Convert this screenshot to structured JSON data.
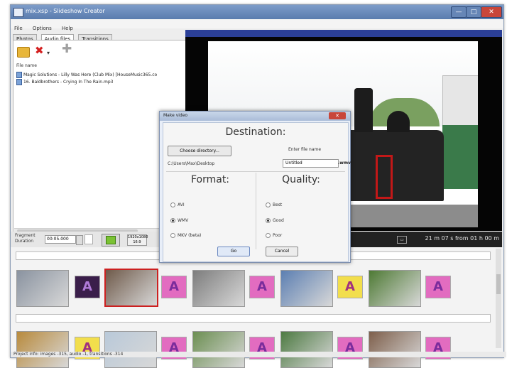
{
  "window": {
    "title": "mix.xsp - Slideshow Creator",
    "min": "—",
    "max": "□",
    "close": "✕"
  },
  "menu": [
    "File",
    "Options",
    "Help"
  ],
  "tabs": [
    "Photos",
    "Audio files",
    "Transitions"
  ],
  "audio_list": {
    "column": "File name",
    "files": [
      "Magic Solutions - Lilly Was Here (Club Mix) [HouseMusic365.co",
      "16. Baldbrothers - Crying In The Rain.mp3"
    ]
  },
  "toolbar_icons": [
    "folder-open-icon",
    "remove-icon",
    "dropdown-icon",
    "add-icon"
  ],
  "fragment": {
    "label_line1": "Fragment",
    "label_line2": "Duration",
    "value": "00:05.000",
    "resolution_line1": "1920x1080",
    "resolution_line2": "16:9"
  },
  "preview": {
    "time_text": "21 m 07 s   from 01 h 00 m",
    "icon": "▭"
  },
  "status": "Project info: images -315, audio -1, transitions -314",
  "dialog": {
    "title": "Make video",
    "close": "✕",
    "destination": "Destination:",
    "choose_dir": "Choose directory...",
    "file_name_label": "Enter file name",
    "directory": "C:\\Users\\Max\\Desktop",
    "file_name": "Untitled",
    "extension": ".wmv",
    "format_title": "Format:",
    "formats": [
      {
        "label": "AVI",
        "selected": false
      },
      {
        "label": "WMV",
        "selected": true
      },
      {
        "label": "MKV (beta)",
        "selected": false
      }
    ],
    "quality_title": "Quality:",
    "qualities": [
      {
        "label": "Best",
        "selected": false
      },
      {
        "label": "Good",
        "selected": true
      },
      {
        "label": "Poor",
        "selected": false
      }
    ],
    "go": "Go",
    "cancel": "Cancel"
  },
  "timeline": {
    "transition_glyph": "A",
    "row1_thumbs": [
      "#8a93a0",
      "#6f5a4a",
      "#7d7d7d",
      "#5c7fb2",
      "#4e7a34"
    ],
    "row2_thumbs": [
      "#b88a3c",
      "#b9c9d9",
      "#6c8f52",
      "#4d7a42",
      "#7e5f4b"
    ]
  }
}
